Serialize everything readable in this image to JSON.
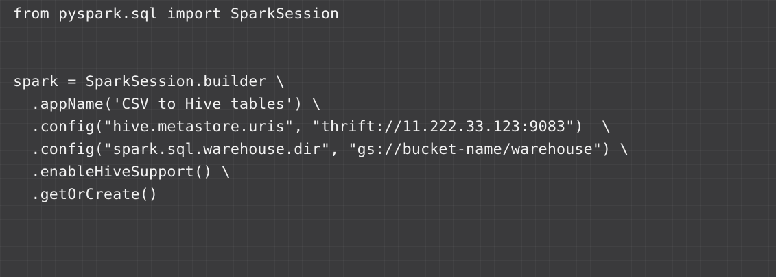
{
  "code": {
    "language": "python",
    "lines": [
      "from pyspark.sql import SparkSession",
      "",
      "",
      "spark = SparkSession.builder \\",
      "  .appName('CSV to Hive tables') \\",
      "  .config(\"hive.metastore.uris\", \"thrift://11.222.33.123:9083\")  \\",
      "  .config(\"spark.sql.warehouse.dir\", \"gs://bucket-name/warehouse\") \\",
      "  .enableHiveSupport() \\",
      "  .getOrCreate()"
    ]
  },
  "colors": {
    "background": "#3a3a3c",
    "text": "#f2f2f2"
  }
}
